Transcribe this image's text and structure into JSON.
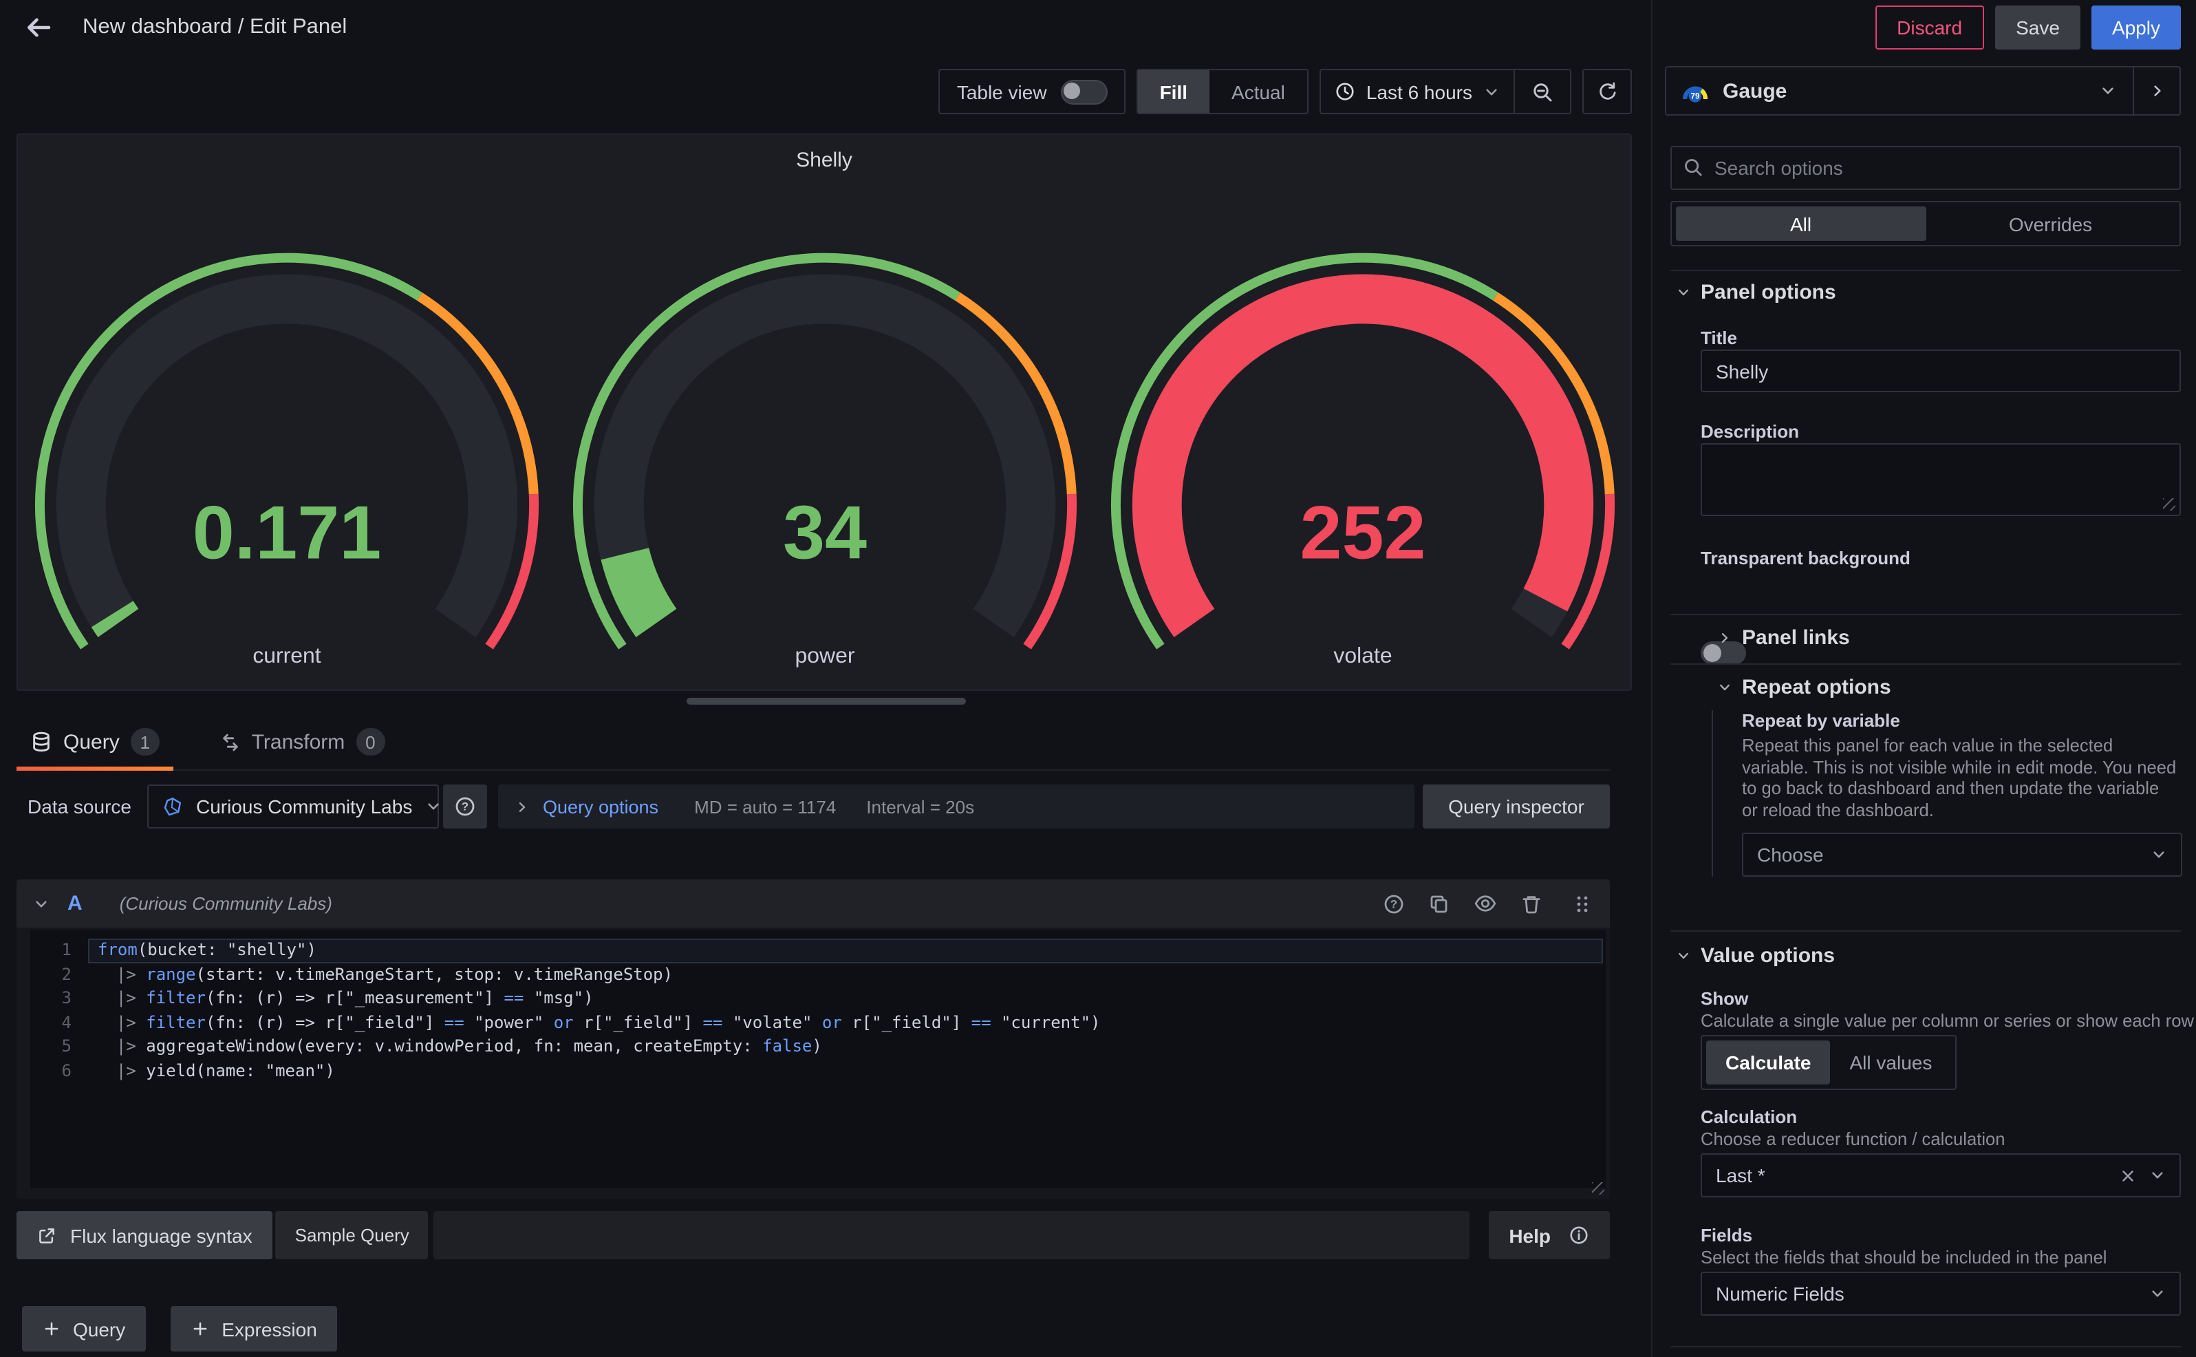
{
  "topbar": {
    "title": "New dashboard / Edit Panel",
    "discard": "Discard",
    "save": "Save",
    "apply": "Apply"
  },
  "toolbar": {
    "table_view": "Table view",
    "fill": "Fill",
    "actual": "Actual",
    "time_range": "Last 6 hours"
  },
  "panel": {
    "title": "Shelly",
    "thresholds": [
      {
        "color": "#73bf69",
        "to": 0.63
      },
      {
        "color": "#ff9830",
        "to": 0.85
      },
      {
        "color": "#f2495c",
        "to": 1
      }
    ],
    "gauges": [
      {
        "label": "current",
        "value": "0.171",
        "fraction": 0.012,
        "color": "#73bf69"
      },
      {
        "label": "power",
        "value": "34",
        "fraction": 0.085,
        "color": "#73bf69"
      },
      {
        "label": "volate",
        "value": "252",
        "fraction": 0.97,
        "color": "#f2495c"
      }
    ]
  },
  "tabs": {
    "query": "Query",
    "query_count": "1",
    "transform": "Transform",
    "transform_count": "0"
  },
  "datasource": {
    "label": "Data source",
    "name": "Curious Community Labs",
    "options_link": "Query options",
    "md": "MD = auto = 1174",
    "interval": "Interval = 20s",
    "inspector": "Query inspector"
  },
  "query_a": {
    "letter": "A",
    "source": "(Curious Community Labs)"
  },
  "code": {
    "lines": [
      [
        [
          "k",
          "from"
        ],
        [
          "p",
          "(bucket: \"shelly\")"
        ]
      ],
      [
        [
          "d",
          "  |> "
        ],
        [
          "k",
          "range"
        ],
        [
          "p",
          "(start: v.timeRangeStart, stop: v.timeRangeStop)"
        ]
      ],
      [
        [
          "d",
          "  |> "
        ],
        [
          "k",
          "filter"
        ],
        [
          "p",
          "(fn: (r) => r[\"_measurement\"] "
        ],
        [
          "k",
          "=="
        ],
        [
          "p",
          " \"msg\")"
        ]
      ],
      [
        [
          "d",
          "  |> "
        ],
        [
          "k",
          "filter"
        ],
        [
          "p",
          "(fn: (r) => r[\"_field\"] "
        ],
        [
          "k",
          "=="
        ],
        [
          "p",
          " \"power\" "
        ],
        [
          "k",
          "or"
        ],
        [
          "p",
          " r[\"_field\"] "
        ],
        [
          "k",
          "=="
        ],
        [
          "p",
          " \"volate\" "
        ],
        [
          "k",
          "or"
        ],
        [
          "p",
          " r[\"_field\"] "
        ],
        [
          "k",
          "=="
        ],
        [
          "p",
          " \"current\")"
        ]
      ],
      [
        [
          "d",
          "  |> "
        ],
        [
          "p",
          "aggregateWindow(every: v.windowPeriod, fn: mean, createEmpty: "
        ],
        [
          "k",
          "false"
        ],
        [
          "p",
          ")"
        ]
      ],
      [
        [
          "d",
          "  |> "
        ],
        [
          "p",
          "yield(name: \"mean\")"
        ]
      ]
    ]
  },
  "query_footer": {
    "flux_syntax": "Flux language syntax",
    "sample_query": "Sample Query",
    "help": "Help"
  },
  "add_buttons": {
    "query": "Query",
    "expression": "Expression"
  },
  "sidebar": {
    "viz_name": "Gauge",
    "search_placeholder": "Search options",
    "filter_tabs": {
      "all": "All",
      "overrides": "Overrides"
    },
    "panel_options": {
      "heading": "Panel options",
      "title_label": "Title",
      "title_value": "Shelly",
      "description_label": "Description",
      "transparent_label": "Transparent background"
    },
    "panel_links": {
      "heading": "Panel links"
    },
    "repeat_options": {
      "heading": "Repeat options",
      "repeat_label": "Repeat by variable",
      "repeat_desc": "Repeat this panel for each value in the selected variable. This is not visible while in edit mode. You need to go back to dashboard and then update the variable or reload the dashboard.",
      "choose_placeholder": "Choose"
    },
    "value_options": {
      "heading": "Value options",
      "show_label": "Show",
      "show_desc": "Calculate a single value per column or series or show each row",
      "calculate": "Calculate",
      "all_values": "All values",
      "calculation_label": "Calculation",
      "calculation_desc": "Choose a reducer function / calculation",
      "calculation_value": "Last *",
      "fields_label": "Fields",
      "fields_desc": "Select the fields that should be included in the panel",
      "fields_value": "Numeric Fields"
    }
  },
  "colors": {
    "green": "#73bf69",
    "orange": "#ff9830",
    "red": "#f2495c",
    "accent_blue": "#3d71d9",
    "link_blue": "#6e9fff"
  }
}
